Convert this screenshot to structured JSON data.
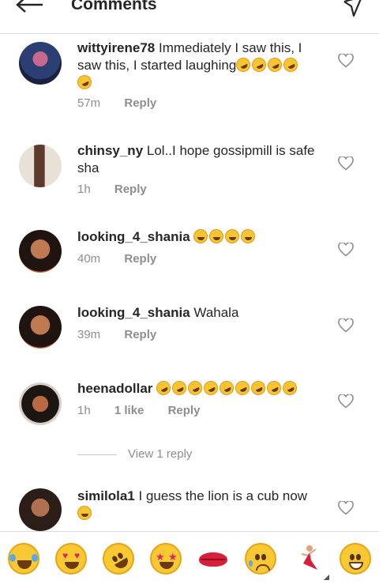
{
  "header": {
    "title": "Comments",
    "back_icon": "arrow-left-icon",
    "send_icon": "send-icon"
  },
  "comments": [
    {
      "username": "wittyirene78",
      "text": "Immediately I saw this, I saw this, I started laughing",
      "emojis": "rolling-on-floor-laughing x5",
      "time": "57m",
      "likes": "",
      "reply": "Reply"
    },
    {
      "username": "chinsy_ny",
      "text": "Lol..I hope gossipmill is safe sha",
      "emojis": "",
      "time": "1h",
      "likes": "",
      "reply": "Reply"
    },
    {
      "username": "looking_4_shania",
      "text": "",
      "emojis": "tears-of-joy x4",
      "time": "40m",
      "likes": "",
      "reply": "Reply"
    },
    {
      "username": "looking_4_shania",
      "text": "Wahala",
      "emojis": "",
      "time": "39m",
      "likes": "",
      "reply": "Reply"
    },
    {
      "username": "heenadollar",
      "text": "",
      "emojis": "rolling-on-floor-laughing x9",
      "time": "1h",
      "likes": "1 like",
      "reply": "Reply"
    },
    {
      "username": "similola1",
      "text": "I guess the lion is a cub now",
      "emojis": "grinning-squinting x1",
      "time": "",
      "likes": "",
      "reply": ""
    }
  ],
  "view_replies": "View 1 reply",
  "emoji_bar": [
    "tears-of-joy",
    "heart-eyes",
    "rolling-on-floor-laughing",
    "star-struck",
    "kiss-mark",
    "sad-but-relieved",
    "dancer",
    "grinning"
  ],
  "colors": {
    "text": "#262626",
    "muted": "#8e8e8e",
    "divider": "#dbdbdb",
    "emoji_yellow": "#f9c934"
  }
}
